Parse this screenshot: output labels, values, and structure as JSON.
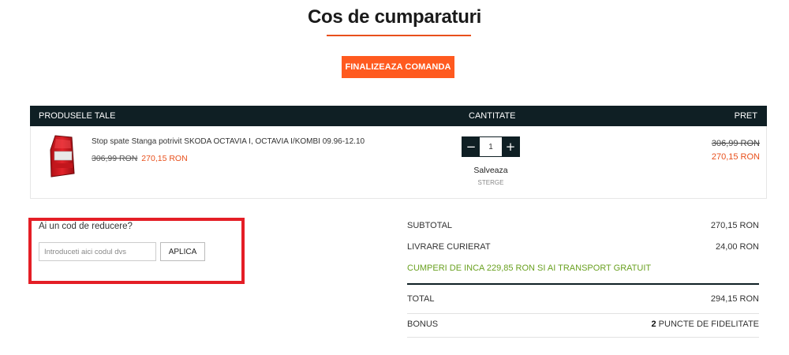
{
  "page": {
    "title": "Cos de cumparaturi",
    "checkout_label": "FINALIZEAZA COMANDA"
  },
  "cart_header": {
    "products": "PRODUSELE TALE",
    "quantity": "CANTITATE",
    "price": "PRET"
  },
  "cart_items": [
    {
      "name": "Stop spate Stanga potrivit SKODA OCTAVIA I, OCTAVIA I/KOMBI 09.96-12.10",
      "old_price": "306,99 RON",
      "new_price": "270,15 RON",
      "quantity": "1",
      "minus": "−",
      "plus": "+",
      "save_label": "Salveaza",
      "delete_label": "STERGE",
      "image": "tail-light-image"
    }
  ],
  "discount": {
    "title": "Ai un cod de reducere?",
    "placeholder": "Introduceti aici codul dvs",
    "apply_label": "APLICA"
  },
  "summary": {
    "subtotal_label": "SUBTOTAL",
    "subtotal_value": "270,15 RON",
    "shipping_label": "LIVRARE CURIERAT",
    "shipping_value": "24,00 RON",
    "free_shipping_notice": "CUMPERI DE INCA 229,85 RON SI AI TRANSPORT GRATUIT",
    "total_label": "TOTAL",
    "total_value": "294,15 RON",
    "bonus_label": "BONUS",
    "bonus_points": "2",
    "bonus_suffix": "PUNCTE DE FIDELITATE"
  },
  "colors": {
    "accent": "#ff5a1f",
    "header_dark": "#0f1f24",
    "sale_price": "#e8501c",
    "free_shipping": "#6aa121",
    "highlight_box": "#e41e26"
  }
}
